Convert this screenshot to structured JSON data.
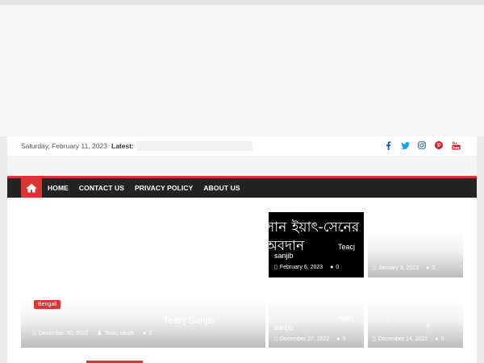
{
  "header": {
    "date": "Saturday, February 11, 2023",
    "latest_label": "Latest:"
  },
  "social_icons": [
    "facebook-icon",
    "twitter-icon",
    "instagram-icon",
    "pinterest-icon",
    "youtube-icon"
  ],
  "nav": {
    "home_icon": "home-icon",
    "items": [
      "HOME",
      "CONTACT US",
      "PRIVACY POLICY",
      "ABOUT US"
    ]
  },
  "featured": {
    "category": "Bengali",
    "title": "Teacj Sanjib",
    "date": "December 30, 2022",
    "author": "Teacj sanjib",
    "comments": "0"
  },
  "grid": [
    {
      "title_bn": "সান ইয়াৎ-সেনের অবদান",
      "title_en": "Teacj",
      "title_en2": "sanjib",
      "date": "February 6, 2023",
      "comments": "0"
    },
    {
      "date": "January 3, 2023",
      "comments": "0"
    },
    {
      "title_a": "teacj",
      "title_b": "sanjib",
      "date": "December 27, 2022",
      "comments": "0"
    },
    {
      "title_a": "?",
      "title_b": "?",
      "date": "December 14, 2022",
      "comments": "0"
    }
  ],
  "colors": {
    "accent": "#dd3333",
    "nav_bg": "#232323"
  }
}
